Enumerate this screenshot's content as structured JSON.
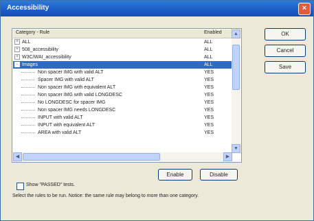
{
  "window": {
    "title": "Accessibility",
    "close_glyph": "×"
  },
  "list": {
    "columns": [
      "Category - Rule",
      "Enabled"
    ],
    "rows": [
      {
        "name": "ALL",
        "enabled": "ALL",
        "level": 0,
        "expander": "+",
        "selected": false
      },
      {
        "name": "508_accessibility",
        "enabled": "ALL",
        "level": 0,
        "expander": "+",
        "selected": false
      },
      {
        "name": "W3C/WAI_accessibility",
        "enabled": "ALL",
        "level": 0,
        "expander": "+",
        "selected": false
      },
      {
        "name": "Images",
        "enabled": "ALL",
        "level": 0,
        "expander": "-",
        "selected": true
      },
      {
        "name": "Non spacer IMG with valid ALT",
        "enabled": "YES",
        "level": 1,
        "selected": false
      },
      {
        "name": "Spacer IMG with valid ALT",
        "enabled": "YES",
        "level": 1,
        "selected": false
      },
      {
        "name": "Non spacer IMG with equivalent ALT",
        "enabled": "YES",
        "level": 1,
        "selected": false
      },
      {
        "name": "Non spacer IMG with valid LONGDESC",
        "enabled": "YES",
        "level": 1,
        "selected": false
      },
      {
        "name": "No LONGDESC for spacer IMG",
        "enabled": "YES",
        "level": 1,
        "selected": false
      },
      {
        "name": "Non spacer IMG needs LONGDESC",
        "enabled": "YES",
        "level": 1,
        "selected": false
      },
      {
        "name": "INPUT with valid ALT",
        "enabled": "YES",
        "level": 1,
        "selected": false
      },
      {
        "name": "INPUT with equivalent ALT",
        "enabled": "YES",
        "level": 1,
        "selected": false
      },
      {
        "name": "AREA with valid ALT",
        "enabled": "YES",
        "level": 1,
        "selected": false
      }
    ]
  },
  "buttons": {
    "ok": "OK",
    "cancel": "Cancel",
    "save": "Save",
    "enable": "Enable",
    "disable": "Disable"
  },
  "show_passed": {
    "label": "Show \"PASSED\" tests.",
    "checked": false
  },
  "note": "Select the rules to be run. Notice: the same rule may belong to more than one category.",
  "colors": {
    "title_bar": "#1a5cc8",
    "selection": "#316ac5",
    "dialog_bg": "#ece9d8"
  }
}
